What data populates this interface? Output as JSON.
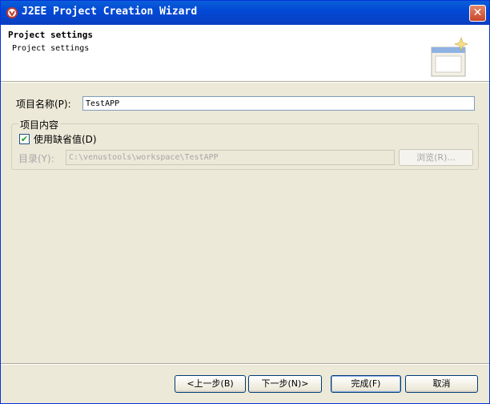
{
  "window": {
    "title": "J2EE Project Creation Wizard"
  },
  "header": {
    "title": "Project settings",
    "description": "Project settings"
  },
  "form": {
    "project_name_label": "项目名称(P):",
    "project_name_value": "TestAPP",
    "group_label": "项目内容",
    "use_default_label": "使用缺省值(D)",
    "use_default_checked": true,
    "directory_label": "目录(Y):",
    "directory_value": "C:\\venustools\\workspace\\TestAPP",
    "browse_label": "浏览(R)..."
  },
  "buttons": {
    "back": "<上一步(B)",
    "next": "下一步(N)>",
    "finish": "完成(F)",
    "cancel": "取消"
  },
  "icons": {
    "app": "app-icon",
    "close": "close-icon",
    "wizard_graphic": "wizard-banner-icon"
  },
  "colors": {
    "titlebar": "#0a5fd8",
    "window_bg": "#ece9d8",
    "header_bg": "#ffffff",
    "check": "#21a121"
  }
}
